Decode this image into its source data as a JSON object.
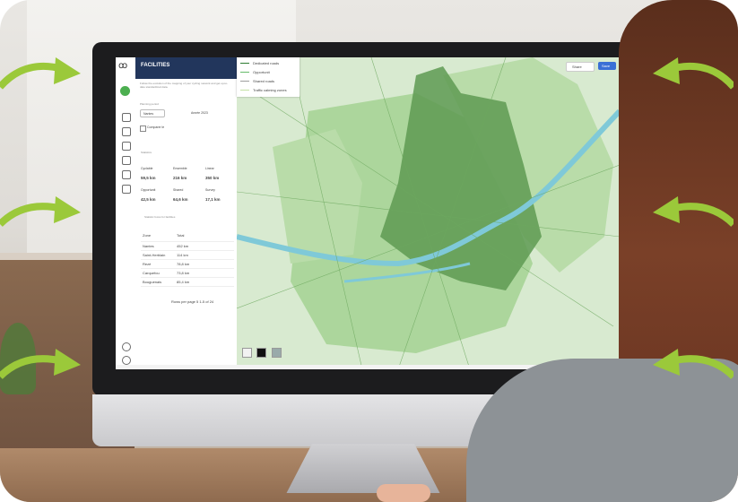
{
  "app": {
    "title": "FACILITIES",
    "intro": "Follow the evolution of the mapping of your cycling network and get up-to-date standardized data.",
    "planning_period_label": "Planning period",
    "region_select": "Nantes",
    "period": "Année 2023",
    "compare_label": "Comparer le",
    "statistics_label": "Statistics",
    "table_header": "Statistic focus for facilities"
  },
  "stats": [
    {
      "label": "Cyclable",
      "value": "59,5 km"
    },
    {
      "label": "Ensemble",
      "value": "216 km"
    },
    {
      "label": "Linear",
      "value": "350 km"
    },
    {
      "label": "Opportunit",
      "value": "42,5 km"
    },
    {
      "label": "Shared",
      "value": "64,6 km"
    },
    {
      "label": "Survey",
      "value": "17,1 km"
    }
  ],
  "table": {
    "columns": [
      "Zone",
      "Total"
    ],
    "rows": [
      {
        "zone": "Nantes",
        "total": "452 km"
      },
      {
        "zone": "Saint-Herblain",
        "total": "114 km"
      },
      {
        "zone": "Rezé",
        "total": "78,8 km"
      },
      {
        "zone": "Carquefou",
        "total": "73,8 km"
      },
      {
        "zone": "Bouguenais",
        "total": "85,4 km"
      }
    ],
    "pagination": "Rows per page  5  1-5 of 24"
  },
  "legend": {
    "items": [
      "Dedicated roads",
      "Opportunit",
      "Shared roads",
      "Traffic calming zones"
    ]
  },
  "map_controls": {
    "share": "Share",
    "save": "Save"
  },
  "colors": {
    "header": "#22365c",
    "map_base": "#cfe3c4",
    "zone_dark": "#5e9a52",
    "zone_light": "#9fcf8e",
    "river": "#7fc9d8",
    "arrow": "#9bc93a",
    "save_button": "#3a6fd6"
  }
}
